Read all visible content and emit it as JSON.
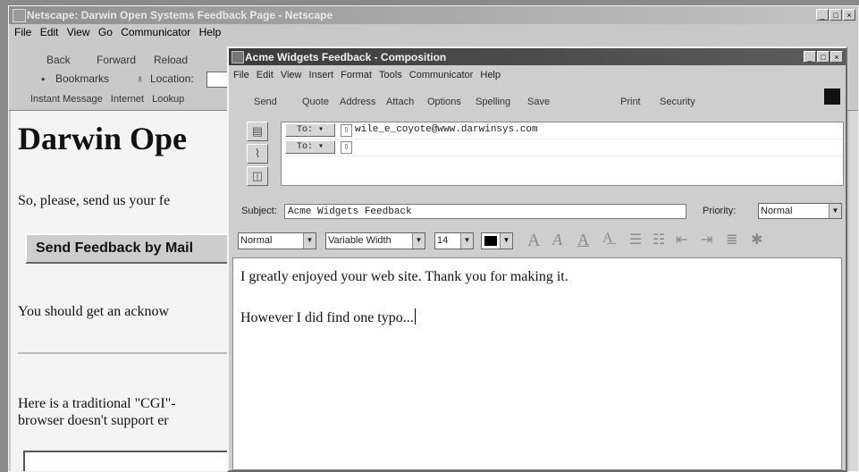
{
  "browser": {
    "title": "Netscape: Darwin Open Systems Feedback Page - Netscape",
    "menu": [
      "File",
      "Edit",
      "View",
      "Go",
      "Communicator",
      "Help"
    ],
    "nav": [
      "Back",
      "Forward",
      "Reload"
    ],
    "bookmarks_label": "Bookmarks",
    "location_label": "Location:",
    "personal_toolbar": [
      "Instant Message",
      "Internet",
      "Lookup"
    ],
    "page": {
      "heading": "Darwin Ope",
      "para1": "So, please, send us your fe",
      "send_button": "Send Feedback by Mail",
      "para2": "You should get an acknow",
      "para3_line1": "Here is a traditional \"CGI\"-",
      "para3_line2": "browser doesn't support er"
    }
  },
  "compose": {
    "title": "Acme Widgets Feedback - Composition",
    "menu": [
      "File",
      "Edit",
      "View",
      "Insert",
      "Format",
      "Tools",
      "Communicator",
      "Help"
    ],
    "toolbar": [
      "Send",
      "Quote",
      "Address",
      "Attach",
      "Options",
      "Spelling",
      "Save",
      "Print",
      "Security"
    ],
    "to_label": "To:",
    "recipients": [
      "wile_e_coyote@www.darwinsys.com",
      ""
    ],
    "subject_label": "Subject:",
    "subject": "Acme Widgets Feedback",
    "priority_label": "Priority:",
    "priority": "Normal",
    "format": {
      "paragraph": "Normal",
      "font": "Variable Width",
      "size": "14",
      "color": "#000000"
    },
    "body_line1": "I greatly enjoyed your web site. Thank you for making it.",
    "body_line2": "However I did find one typo..."
  }
}
